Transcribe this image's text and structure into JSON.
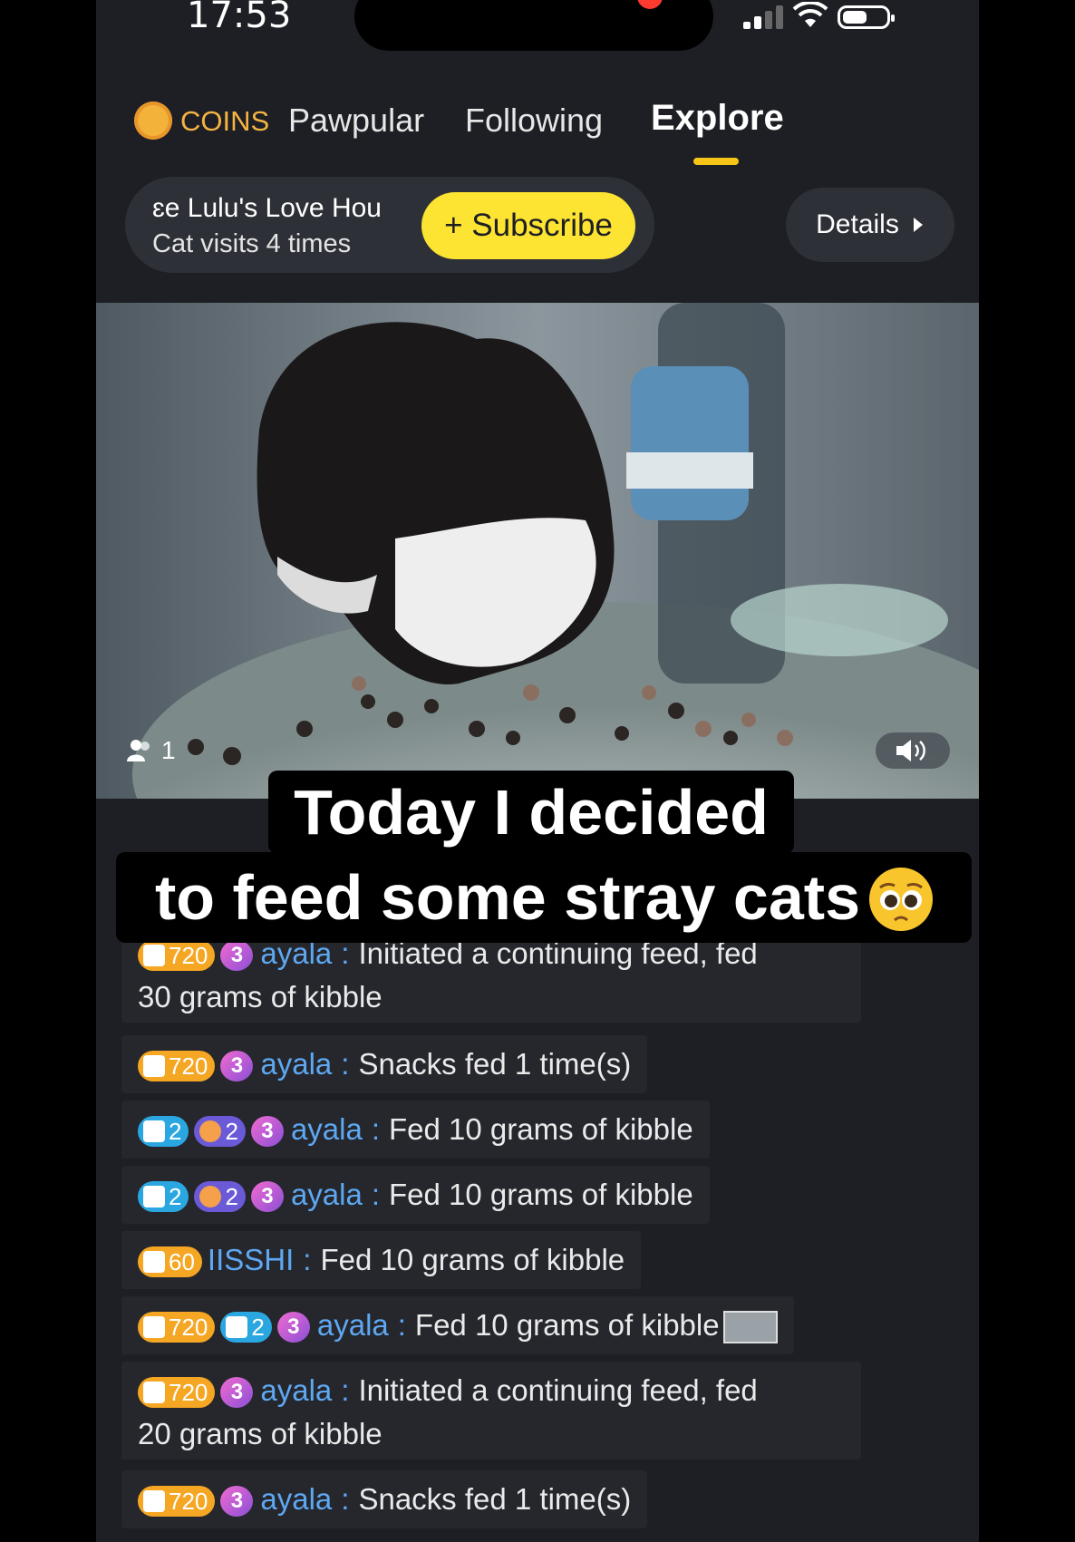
{
  "status_bar": {
    "time": "17:53"
  },
  "header": {
    "coins_label": "COINS",
    "tabs": [
      {
        "label": "Pawpular",
        "active": false
      },
      {
        "label": "Following",
        "active": false
      },
      {
        "label": "Explore",
        "active": true
      }
    ]
  },
  "channel": {
    "name": "ɛe  Lulu's Love Hou",
    "visits": "Cat visits 4 times",
    "subscribe_label": "+ Subscribe",
    "details_label": "Details"
  },
  "video": {
    "viewer_count": "1"
  },
  "caption": {
    "line1": "Today I decided",
    "line2": "to feed some stray cats"
  },
  "feed": [
    {
      "badges": [
        {
          "type": "orange",
          "value": "720"
        }
      ],
      "level": "3",
      "user": "ayala",
      "line1": "Initiated a continuing feed, fed",
      "line2": "30 grams of kibble"
    },
    {
      "badges": [
        {
          "type": "orange",
          "value": "720"
        }
      ],
      "level": "3",
      "user": "ayala",
      "line1": "Snacks fed 1 time(s)"
    },
    {
      "badges": [
        {
          "type": "cyan",
          "value": "2"
        },
        {
          "type": "blue",
          "value": "2"
        }
      ],
      "level": "3",
      "user": "ayala",
      "line1": "Fed 10 grams of kibble"
    },
    {
      "badges": [
        {
          "type": "cyan",
          "value": "2"
        },
        {
          "type": "blue",
          "value": "2"
        }
      ],
      "level": "3",
      "user": "ayala",
      "line1": "Fed 10 grams of kibble"
    },
    {
      "badges": [
        {
          "type": "orange",
          "value": "60"
        }
      ],
      "level": "",
      "user": "IISSHI",
      "line1": "Fed 10 grams of kibble"
    },
    {
      "badges": [
        {
          "type": "orange",
          "value": "720"
        },
        {
          "type": "cyan",
          "value": "2"
        }
      ],
      "level": "3",
      "user": "ayala",
      "line1": "Fed 10 grams of kibble",
      "thumb": true
    },
    {
      "badges": [
        {
          "type": "orange",
          "value": "720"
        }
      ],
      "level": "3",
      "user": "ayala",
      "line1": "Initiated a continuing feed, fed",
      "line2": "20 grams of kibble"
    },
    {
      "badges": [
        {
          "type": "orange",
          "value": "720"
        }
      ],
      "level": "3",
      "user": "ayala",
      "line1": "Snacks fed 1 time(s)"
    }
  ]
}
